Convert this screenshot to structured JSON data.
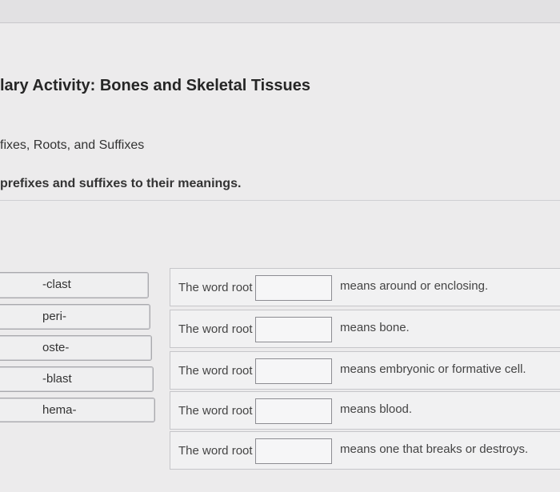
{
  "header": {
    "title": "lary Activity: Bones and Skeletal Tissues",
    "subtitle": "fixes, Roots, and Suffixes",
    "instruction": "prefixes and suffixes to their meanings."
  },
  "terms": [
    "-clast",
    "peri-",
    "oste-",
    "-blast",
    "hema-"
  ],
  "rows": [
    {
      "prefix": "The word root",
      "suffix": "means around or enclosing."
    },
    {
      "prefix": "The word root",
      "suffix": "means bone."
    },
    {
      "prefix": "The word root",
      "suffix": "means embryonic or formative cell."
    },
    {
      "prefix": "The word root",
      "suffix": "means blood."
    },
    {
      "prefix": "The word root",
      "suffix": "means one that breaks or destroys."
    }
  ]
}
